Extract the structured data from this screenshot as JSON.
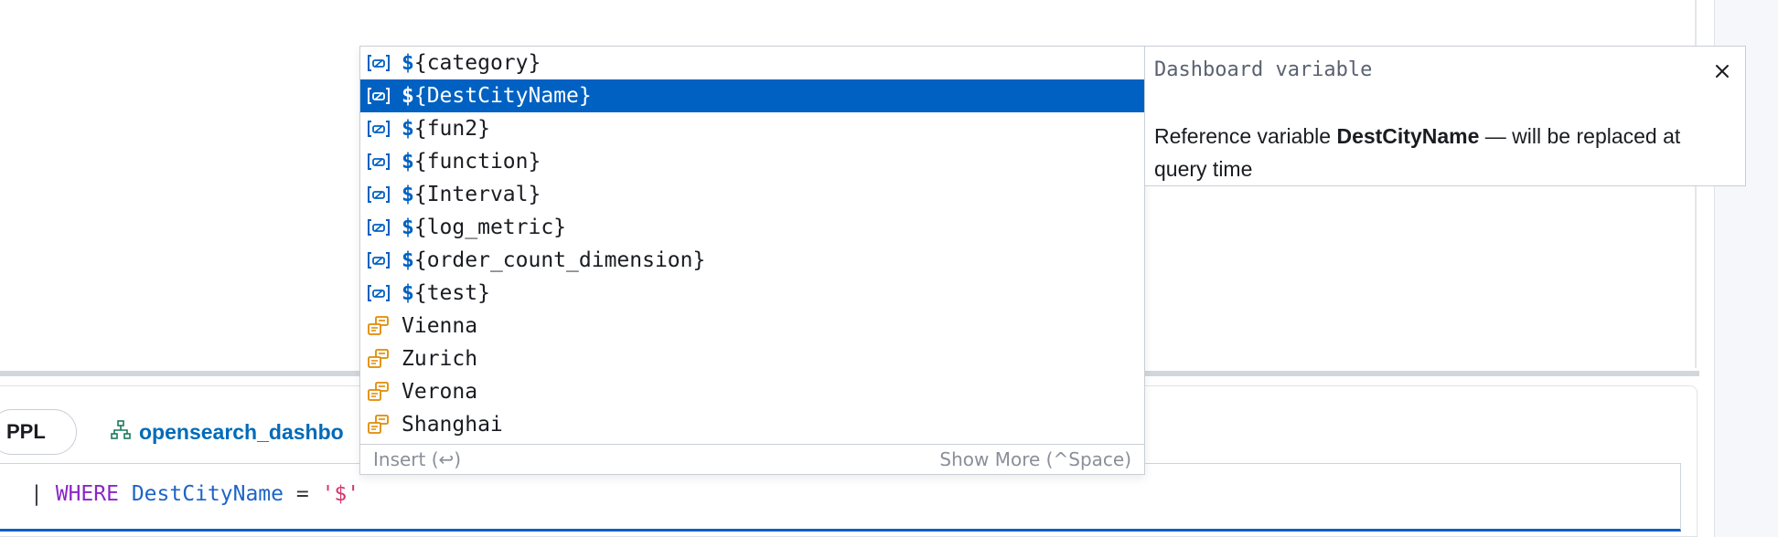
{
  "query_bar": {
    "language": "PPL",
    "index_pattern": "opensearch_dashbo"
  },
  "editor": {
    "pipe": "|",
    "keyword": "WHERE",
    "field": "DestCityName",
    "operator": "=",
    "string_literal": "'$'"
  },
  "suggestions": {
    "items": [
      {
        "prefix": "$",
        "rest": "{category}",
        "icon": "variable-icon"
      },
      {
        "prefix": "$",
        "rest": "{DestCityName}",
        "icon": "variable-icon",
        "selected": true
      },
      {
        "prefix": "$",
        "rest": "{fun2}",
        "icon": "variable-icon"
      },
      {
        "prefix": "$",
        "rest": "{function}",
        "icon": "variable-icon"
      },
      {
        "prefix": "$",
        "rest": "{Interval}",
        "icon": "variable-icon"
      },
      {
        "prefix": "$",
        "rest": "{log_metric}",
        "icon": "variable-icon"
      },
      {
        "prefix": "$",
        "rest": "{order_count_dimension}",
        "icon": "variable-icon"
      },
      {
        "prefix": "$",
        "rest": "{test}",
        "icon": "variable-icon"
      },
      {
        "prefix": "",
        "rest": "Vienna",
        "icon": "value-icon"
      },
      {
        "prefix": "",
        "rest": "Zurich",
        "icon": "value-icon"
      },
      {
        "prefix": "",
        "rest": "Verona",
        "icon": "value-icon"
      },
      {
        "prefix": "",
        "rest": "Shanghai",
        "icon": "value-icon"
      }
    ],
    "footer_insert": "Insert (↩)",
    "footer_more": "Show More (^Space)"
  },
  "details": {
    "title": "Dashboard variable",
    "body_prefix": "Reference variable ",
    "body_variable": "DestCityName",
    "body_suffix": " — will be replaced at query time"
  },
  "colors": {
    "selection": "#0061c2",
    "keyword": "#8b27c4",
    "field": "#1e64c8",
    "string": "#d6336c",
    "variable_icon": "#0061c2",
    "value_icon": "#e08b00"
  }
}
